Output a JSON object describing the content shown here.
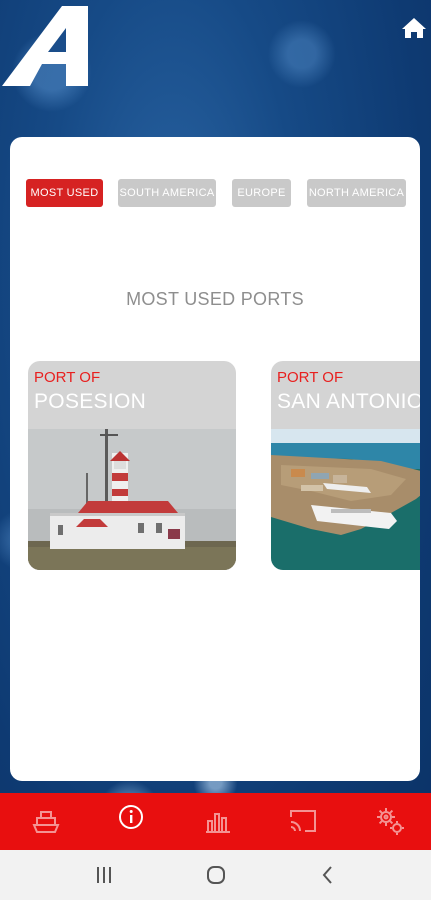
{
  "header": {
    "logo_icon": "a-logo-icon",
    "home_icon": "home-icon"
  },
  "tabs": [
    {
      "label": "MOST USED",
      "active": true
    },
    {
      "label": "SOUTH AMERICA",
      "active": false
    },
    {
      "label": "EUROPE",
      "active": false
    },
    {
      "label": "NORTH AMERICA",
      "active": false
    }
  ],
  "section_title": "MOST USED PORTS",
  "ports": [
    {
      "prefix": "PORT OF",
      "name": "POSESION",
      "photo": "lighthouse-photo"
    },
    {
      "prefix": "PORT OF",
      "name": "SAN ANTONIO",
      "photo": "harbor-photo"
    }
  ],
  "bottom_nav": [
    {
      "icon": "ship-icon"
    },
    {
      "icon": "info-icon",
      "active": true
    },
    {
      "icon": "bar-chart-icon"
    },
    {
      "icon": "cast-icon"
    },
    {
      "icon": "settings-icon"
    }
  ],
  "system_nav": [
    "recent-apps-icon",
    "home-circle-icon",
    "back-icon"
  ],
  "colors": {
    "accent": "#e80f0f",
    "tab_active": "#d62222",
    "tab_inactive": "#c9c9c9",
    "port_prefix": "#e8201f"
  }
}
